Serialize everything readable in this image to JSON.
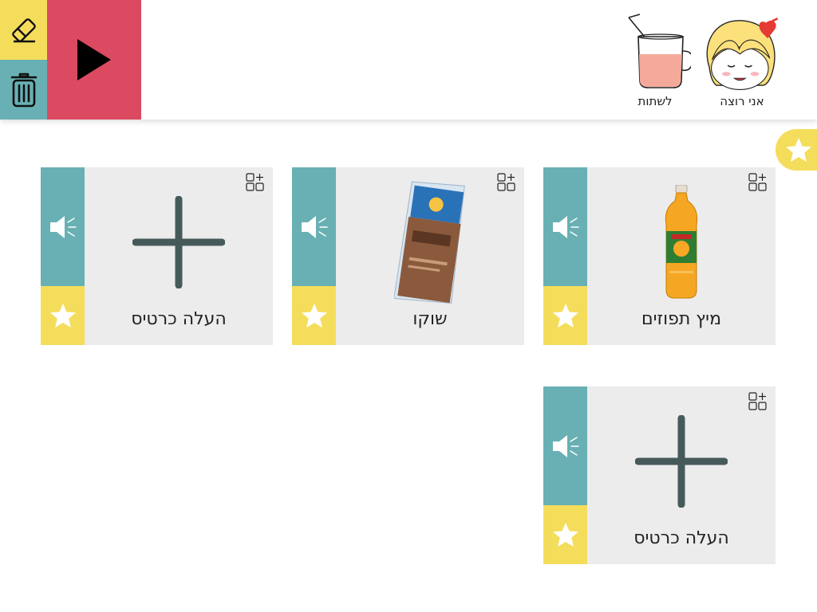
{
  "toolbar": {
    "erase_icon": "eraser-icon",
    "trash_icon": "trash-icon",
    "play_icon": "play-icon"
  },
  "sentence": [
    {
      "label": "אני רוצה",
      "icon": "girl-face-icon"
    },
    {
      "label": "לשתות",
      "icon": "drink-cup-icon"
    }
  ],
  "favorites_tab": {
    "icon": "star-icon"
  },
  "cards": [
    {
      "label": "מיץ תפוזים",
      "image": "orange-juice-bottle"
    },
    {
      "label": "שוקו",
      "image": "chocolate-milk-bag"
    },
    {
      "label": "העלה כרטיס",
      "image": "plus-icon"
    },
    {
      "label": "העלה כרטיס",
      "image": "plus-icon"
    }
  ],
  "colors": {
    "yellow": "#f5dd5c",
    "teal": "#68b0b4",
    "red": "#db4a61",
    "card_bg": "#ececec",
    "dark": "#465a5a"
  }
}
